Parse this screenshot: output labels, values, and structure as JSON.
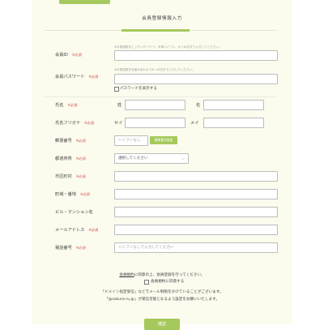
{
  "page": {
    "title": "会員登録情報入力"
  },
  "form": {
    "required_badge": "※必須",
    "member_id": {
      "label": "会員ID",
      "hint": "※半角英数字と_(アンダーバー)、半角ハイフン、6〜16文字で入力してください。",
      "value": ""
    },
    "password": {
      "label": "会員パスワード",
      "hint": "※半角英数字を組み合わせて8〜16文字で入力してください。",
      "value": "",
      "show_label": "パスワードを表示する"
    },
    "name": {
      "label": "氏名",
      "last_label": "姓",
      "first_label": "名",
      "last_value": "",
      "first_value": ""
    },
    "name_kana": {
      "label": "氏名フリガナ",
      "last_label": "セイ",
      "first_label": "メイ",
      "last_value": "",
      "first_value": ""
    },
    "postal": {
      "label": "郵便番号",
      "placeholder": "ハイフンなし",
      "button": "郵便番号検索"
    },
    "prefecture": {
      "label": "都道府県",
      "selected": "選択してください"
    },
    "city": {
      "label": "市区町村",
      "value": ""
    },
    "address": {
      "label": "町域・番地",
      "value": ""
    },
    "building": {
      "label": "ビル・マンション名",
      "value": ""
    },
    "email": {
      "label": "メールアドレス",
      "value": ""
    },
    "phone": {
      "label": "電話番号",
      "placeholder": "ハイフンなしで入力してください"
    }
  },
  "terms": {
    "link_text": "会員規約",
    "line1_rest": "に同意の上、会員登録を行ってください。",
    "agree_label": "会員規約に同意する"
  },
  "notice": {
    "line1": "「ドメイン指定受信」などでメール制限をかけていることがございます。",
    "line2": "「@sakura-ru.jp」が受信可能となるよう設定をお願いいたします。"
  },
  "submit": {
    "label": "確認"
  },
  "colors": {
    "accent": "#a5c95c",
    "required": "#d9534f",
    "panel": "#fbfbee"
  }
}
